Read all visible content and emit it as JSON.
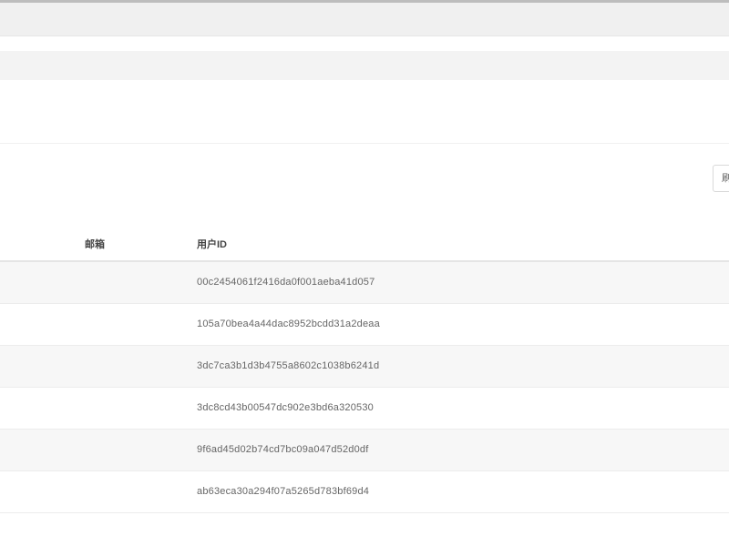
{
  "toolbar": {
    "right_control_label": "刷"
  },
  "table": {
    "headers": [
      "邮箱",
      "用户ID"
    ],
    "rows": [
      {
        "email": "",
        "user_id": "00c2454061f2416da0f001aeba41d057"
      },
      {
        "email": "",
        "user_id": "105a70bea4a44dac8952bcdd31a2deaa"
      },
      {
        "email": "",
        "user_id": "3dc7ca3b1d3b4755a8602c1038b6241d"
      },
      {
        "email": "",
        "user_id": "3dc8cd43b00547dc902e3bd6a320530"
      },
      {
        "email": "",
        "user_id": "9f6ad45d02b74cd7bc09a047d52d0df"
      },
      {
        "email": "",
        "user_id": "ab63eca30a294f07a5265d783bf69d4"
      }
    ]
  }
}
